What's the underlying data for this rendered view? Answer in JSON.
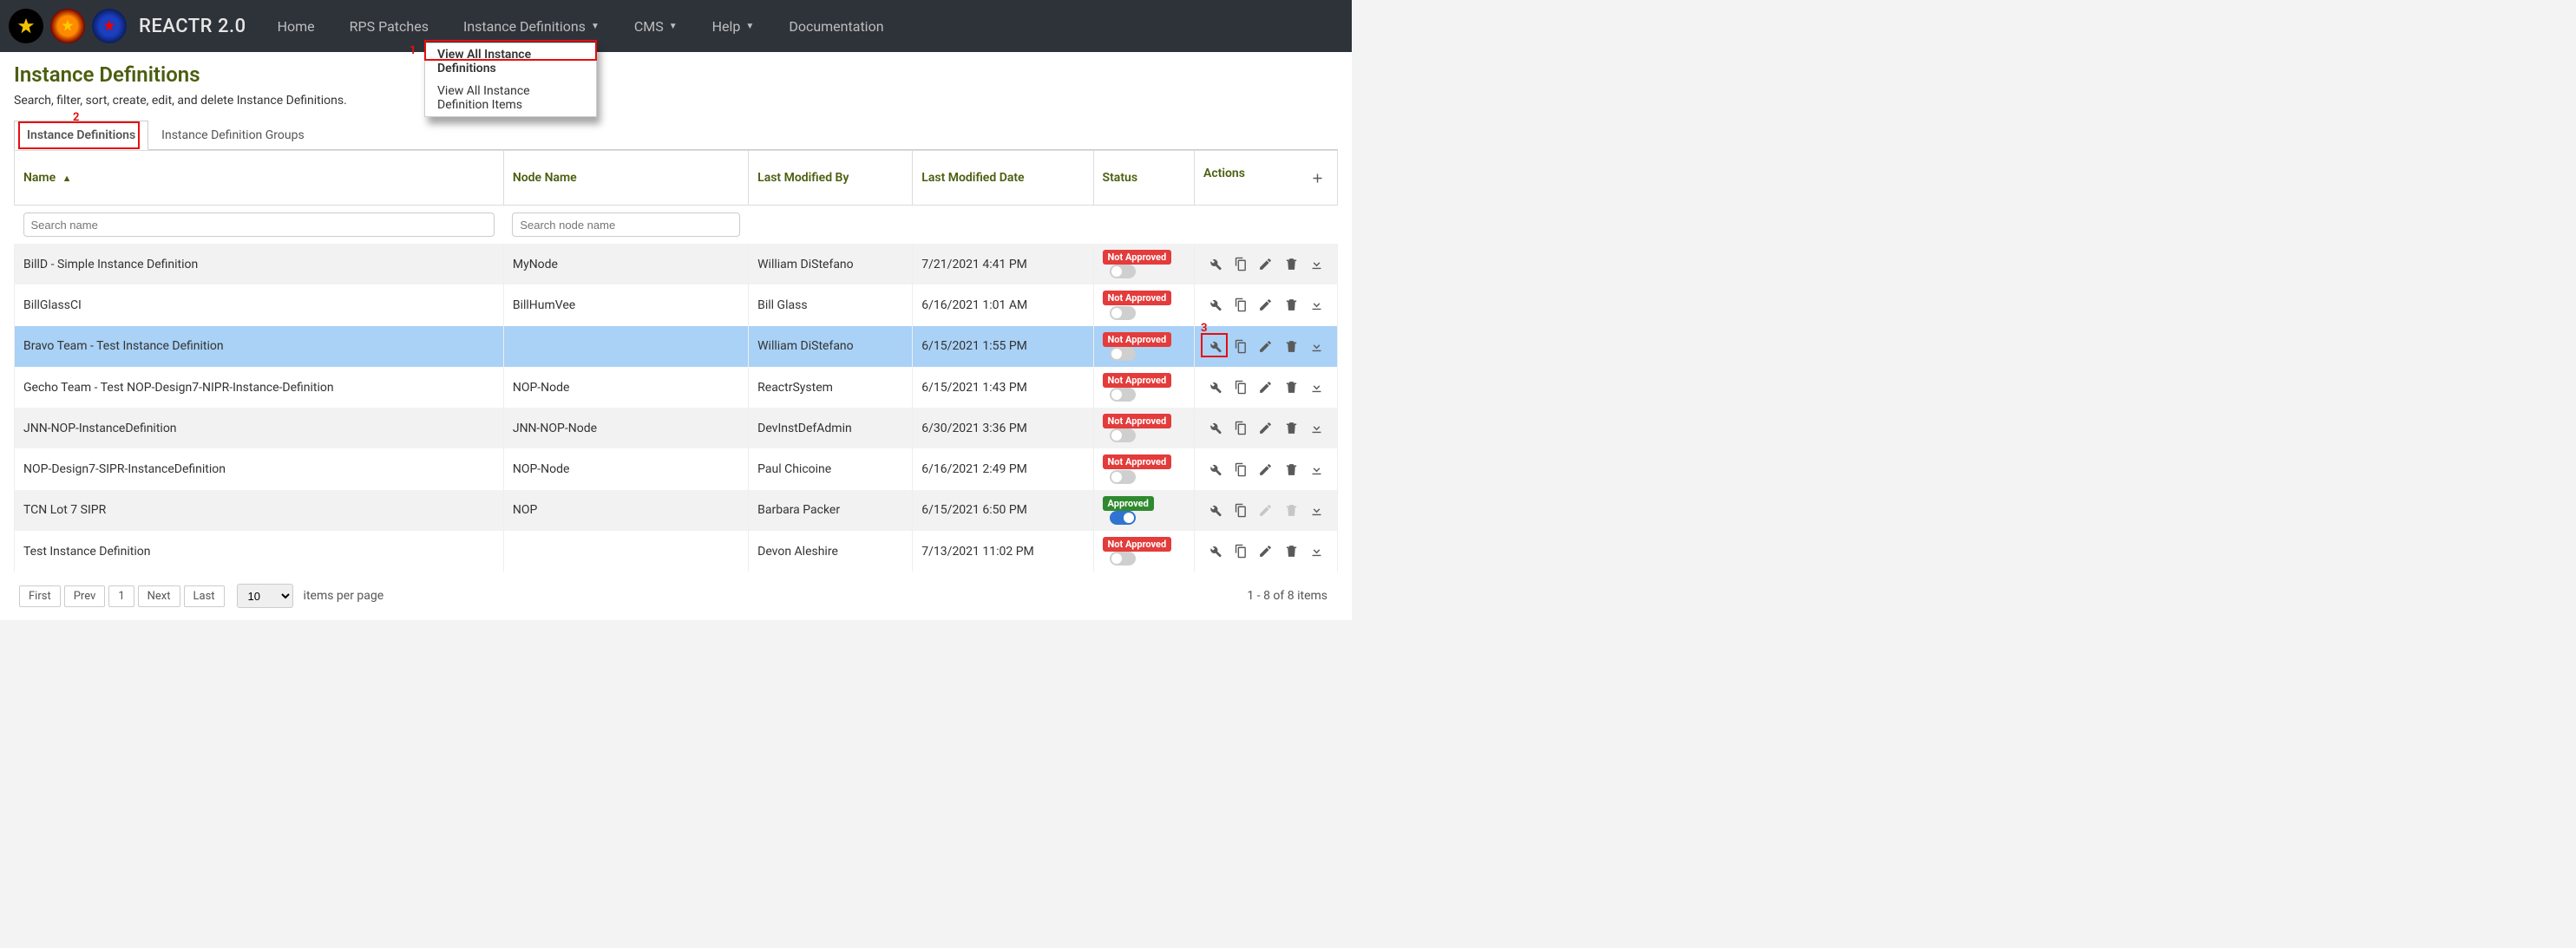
{
  "brand": "REACTR 2.0",
  "nav": {
    "home": "Home",
    "rps": "RPS Patches",
    "instdef": "Instance Definitions",
    "cms": "CMS",
    "help": "Help",
    "doc": "Documentation"
  },
  "dropdown": {
    "view_all": "View All Instance Definitions",
    "view_items": "View All Instance Definition Items"
  },
  "page": {
    "title": "Instance Definitions",
    "subtitle": "Search, filter, sort, create, edit, and delete Instance Definitions."
  },
  "tabs": {
    "defs": "Instance Definitions",
    "groups": "Instance Definition Groups"
  },
  "cols": {
    "name": "Name",
    "node": "Node Name",
    "modby": "Last Modified By",
    "moddate": "Last Modified Date",
    "status": "Status",
    "actions": "Actions"
  },
  "filters": {
    "name_ph": "Search name",
    "node_ph": "Search node name"
  },
  "status_labels": {
    "not": "Not Approved",
    "ok": "Approved"
  },
  "rows": [
    {
      "name": "BillD - Simple Instance Definition",
      "node": "MyNode",
      "modby": "William DiStefano",
      "moddate": "7/21/2021 4:41 PM",
      "status": "not",
      "toggle": false
    },
    {
      "name": "BillGlassCI",
      "node": "BillHumVee",
      "modby": "Bill Glass",
      "moddate": "6/16/2021 1:01 AM",
      "status": "not",
      "toggle": false
    },
    {
      "name": "Bravo Team - Test Instance Definition",
      "node": "",
      "modby": "William DiStefano",
      "moddate": "6/15/2021 1:55 PM",
      "status": "not",
      "toggle": false,
      "selected": true
    },
    {
      "name": "Gecho Team - Test NOP-Design7-NIPR-Instance-Definition",
      "node": "NOP-Node",
      "modby": "ReactrSystem",
      "moddate": "6/15/2021 1:43 PM",
      "status": "not",
      "toggle": false
    },
    {
      "name": "JNN-NOP-InstanceDefinition",
      "node": "JNN-NOP-Node",
      "modby": "DevInstDefAdmin",
      "moddate": "6/30/2021 3:36 PM",
      "status": "not",
      "toggle": false
    },
    {
      "name": "NOP-Design7-SIPR-InstanceDefinition",
      "node": "NOP-Node",
      "modby": "Paul Chicoine",
      "moddate": "6/16/2021 2:49 PM",
      "status": "not",
      "toggle": false
    },
    {
      "name": "TCN Lot 7 SIPR",
      "node": "NOP",
      "modby": "Barbara Packer",
      "moddate": "6/15/2021 6:50 PM",
      "status": "ok",
      "toggle": true,
      "edit_disabled": true,
      "delete_disabled": true
    },
    {
      "name": "Test Instance Definition",
      "node": "",
      "modby": "Devon Aleshire",
      "moddate": "7/13/2021 11:02 PM",
      "status": "not",
      "toggle": false
    }
  ],
  "pager": {
    "first": "First",
    "prev": "Prev",
    "page": "1",
    "next": "Next",
    "last": "Last",
    "page_size": "10",
    "ipp": "items per page",
    "range": "1 - 8 of 8 items"
  },
  "annot": {
    "n1": "1",
    "n2": "2",
    "n3": "3"
  },
  "colors": {
    "accent": "#4b5e0f",
    "danger": "#e43b3b",
    "success": "#2f8a2f",
    "highlight": "#e70d0d",
    "select_row": "#aad1f6"
  }
}
